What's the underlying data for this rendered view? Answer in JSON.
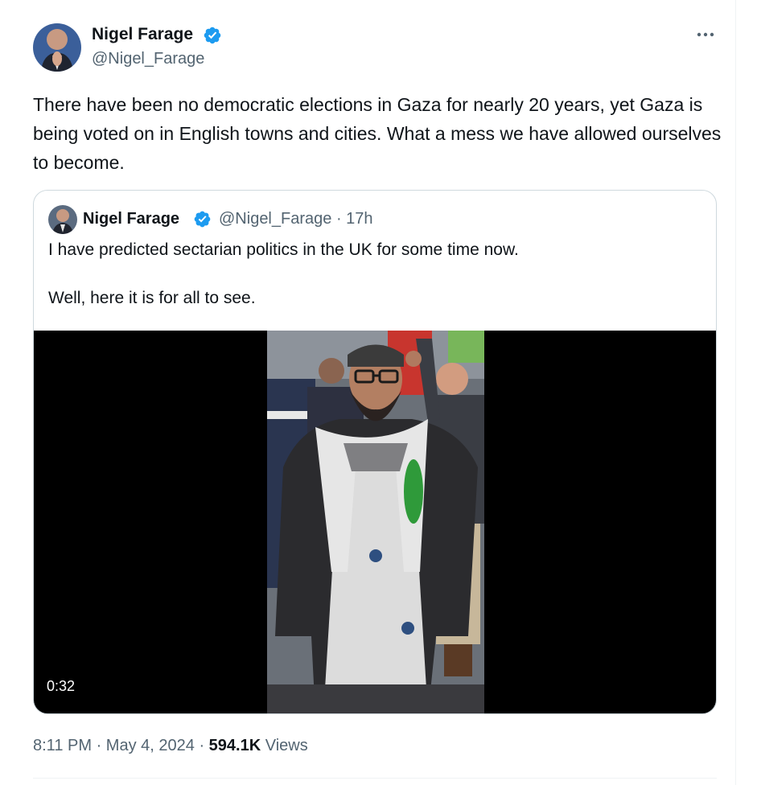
{
  "tweet": {
    "author_name": "Nigel Farage",
    "author_handle": "@Nigel_Farage",
    "text": "There have been no democratic elections in Gaza for nearly 20 years, yet Gaza is being voted on in English towns and cities. What a mess we have allowed ourselves to become.",
    "time": "8:11 PM",
    "date": "May 4, 2024",
    "views_count": "594.1K",
    "views_label": "Views",
    "separator": "·"
  },
  "quote": {
    "author_name": "Nigel Farage",
    "author_handle": "@Nigel_Farage",
    "age": "17h",
    "separator": "·",
    "text_line1": "I have predicted sectarian politics in the UK for some time now.",
    "text_line2": "Well, here it is for all to see.",
    "video_duration": "0:32"
  },
  "colors": {
    "verified_badge": "#1d9bf0",
    "secondary_text": "#536471",
    "primary_text": "#0f1419",
    "border": "#cfd9de"
  },
  "icons": {
    "verified": "verified-badge-icon",
    "more": "more-options-icon"
  }
}
